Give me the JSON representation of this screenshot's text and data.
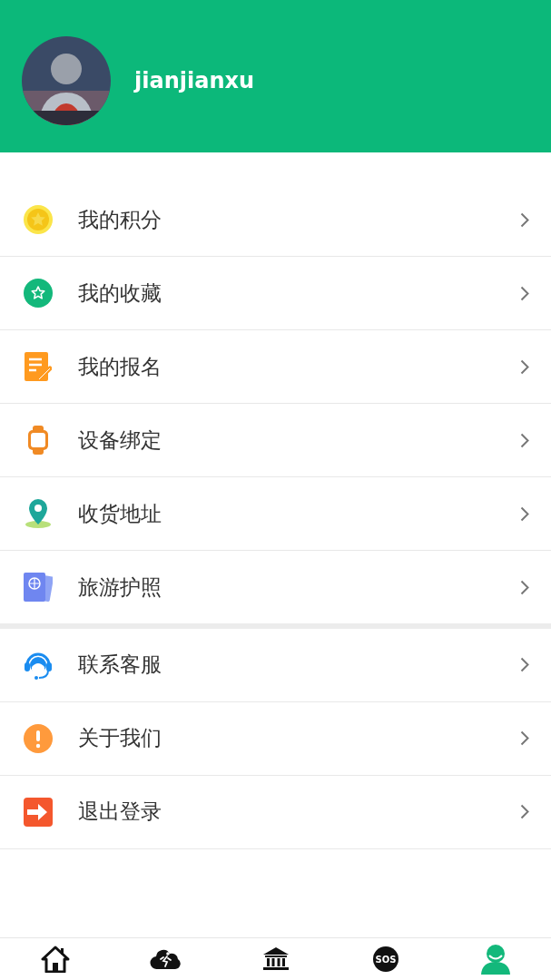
{
  "user": {
    "name": "jianjianxu"
  },
  "menu_groups": [
    {
      "items": [
        {
          "kind": "points",
          "label": "我的积分"
        },
        {
          "kind": "favorites",
          "label": "我的收藏"
        },
        {
          "kind": "signup",
          "label": "我的报名"
        },
        {
          "kind": "device",
          "label": "设备绑定"
        },
        {
          "kind": "address",
          "label": "收货地址"
        },
        {
          "kind": "passport",
          "label": "旅游护照"
        }
      ]
    },
    {
      "items": [
        {
          "kind": "service",
          "label": "联系客服"
        },
        {
          "kind": "about",
          "label": "关于我们"
        },
        {
          "kind": "logout",
          "label": "退出登录"
        }
      ]
    }
  ],
  "tab_bar": [
    {
      "kind": "home",
      "selected": false
    },
    {
      "kind": "run",
      "selected": false
    },
    {
      "kind": "museum",
      "selected": false
    },
    {
      "kind": "sos",
      "label": "SOS",
      "selected": false
    },
    {
      "kind": "profile",
      "selected": true
    }
  ]
}
